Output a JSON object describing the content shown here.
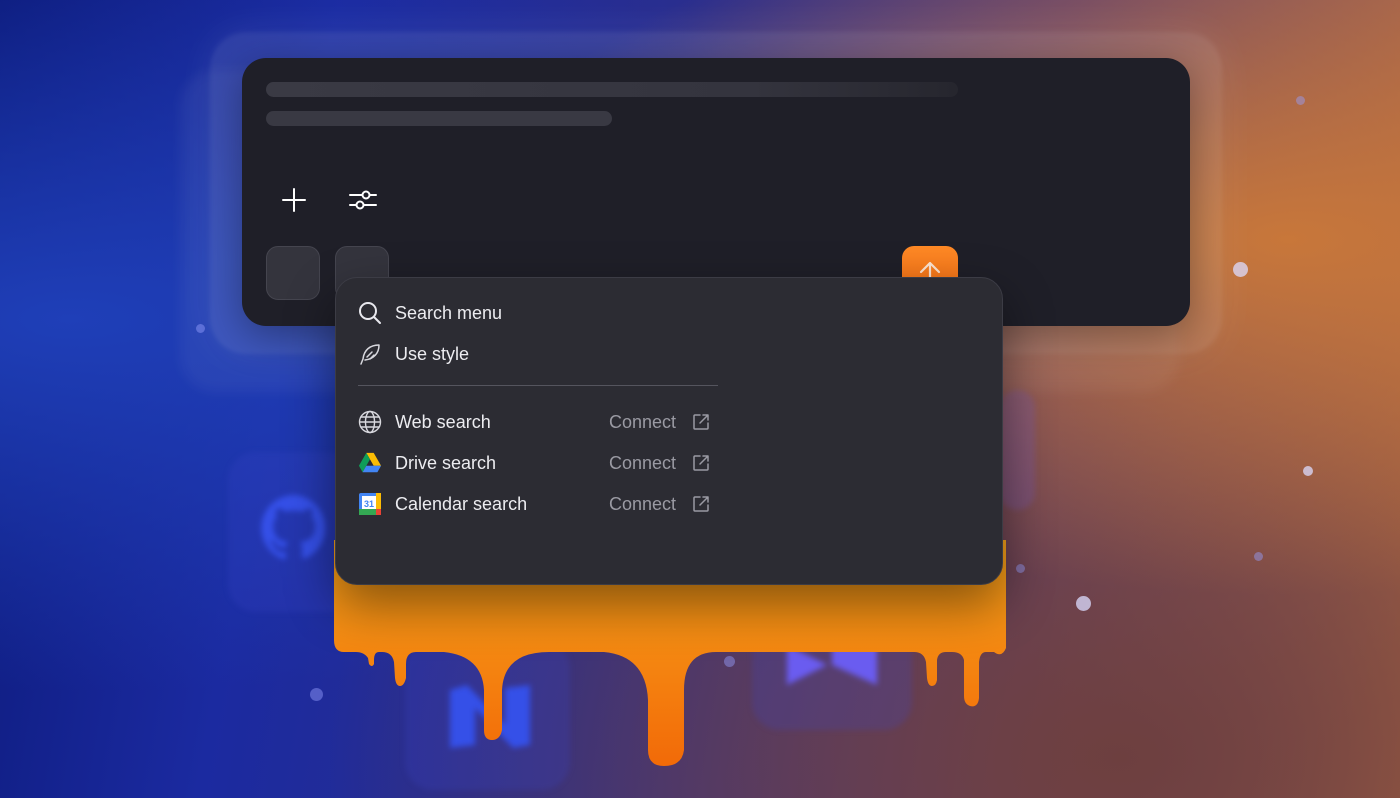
{
  "menu": {
    "search_label": "Search menu",
    "style_label": "Use style",
    "items": [
      {
        "label": "Web search",
        "action": "Connect",
        "icon": "globe-icon"
      },
      {
        "label": "Drive search",
        "action": "Connect",
        "icon": "google-drive-icon"
      },
      {
        "label": "Calendar search",
        "action": "Connect",
        "icon": "google-calendar-icon"
      }
    ],
    "calendar_day": "31"
  },
  "composer": {
    "icons": [
      "plus-icon",
      "sliders-icon",
      "send-arrow-icon"
    ]
  },
  "colors": {
    "accent": "#f47a18",
    "panel": "#1f1f28",
    "menu": "#2c2c33"
  }
}
